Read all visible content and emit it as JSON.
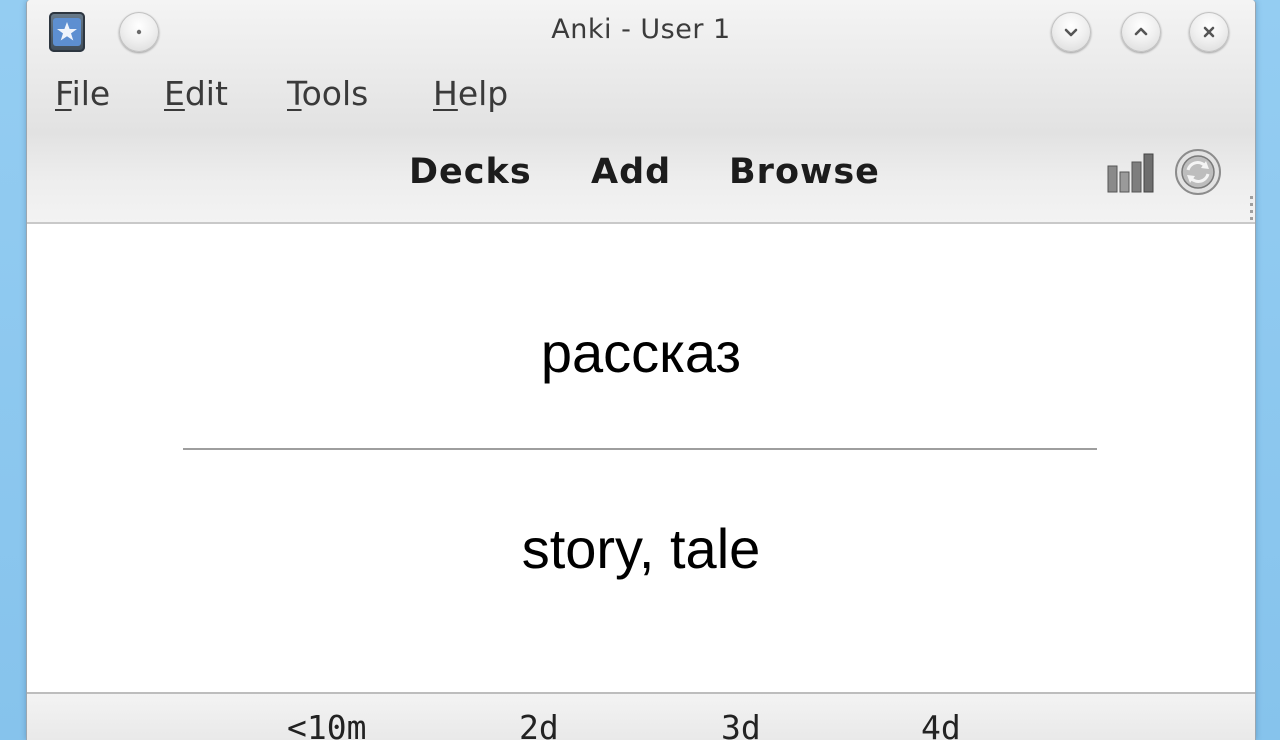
{
  "window": {
    "title": "Anki - User 1"
  },
  "menubar": {
    "items": [
      {
        "first": "F",
        "rest": "ile"
      },
      {
        "first": "E",
        "rest": "dit"
      },
      {
        "first": "T",
        "rest": "ools"
      },
      {
        "first": "H",
        "rest": "elp"
      }
    ]
  },
  "toolbar": {
    "links": [
      "Decks",
      "Add",
      "Browse"
    ],
    "right_icons": [
      "stats-icon",
      "sync-icon"
    ]
  },
  "card": {
    "front": "рассказ",
    "back": "story, tale"
  },
  "answer_bar": {
    "intervals": [
      "<10m",
      "2d",
      "3d",
      "4d"
    ]
  },
  "icons": {
    "app": "anki-star-icon",
    "sticky": "pin-dot-icon",
    "minimize": "chevron-down-icon",
    "maximize": "chevron-up-icon",
    "close": "close-icon"
  },
  "colors": {
    "desktop": "#8ec9ef",
    "chrome": "#e8e8e8",
    "card_text": "#000000"
  }
}
